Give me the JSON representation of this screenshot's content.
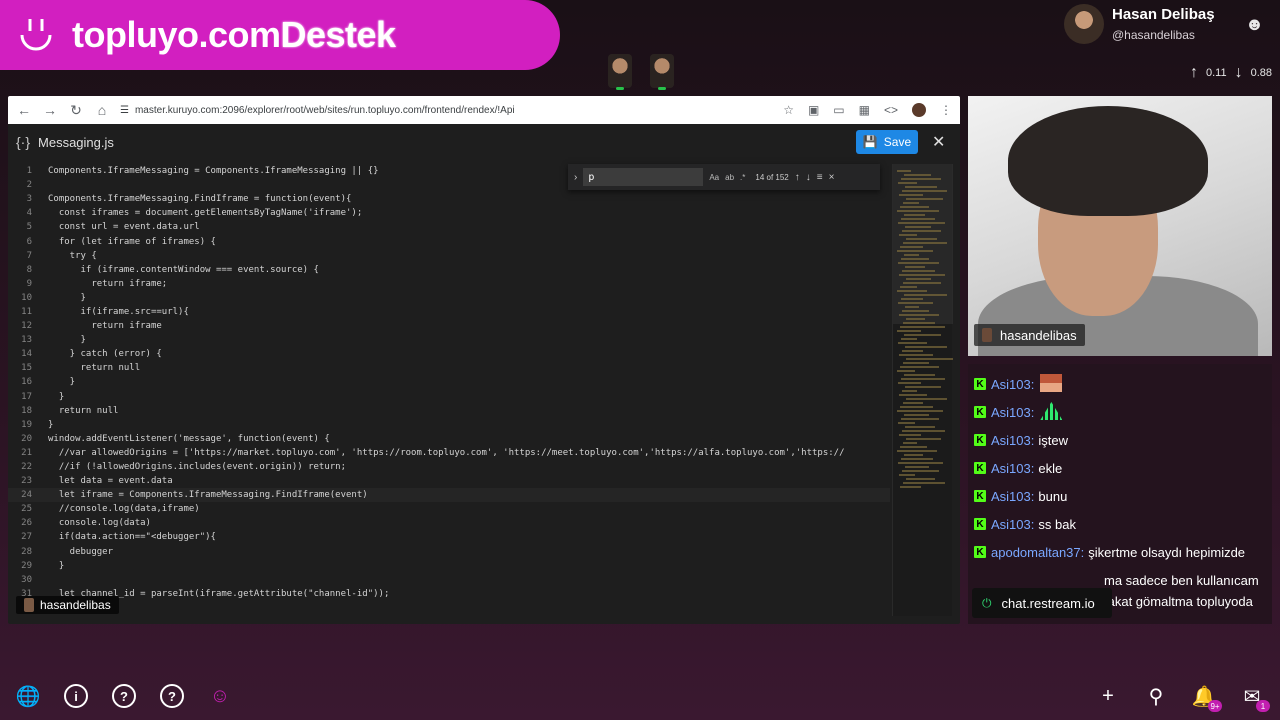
{
  "brand": {
    "name": "topluyo.com",
    "suffix": "Destek"
  },
  "user": {
    "name": "Hasan Delibaş",
    "handle": "@hasandelibas",
    "up": "0.11",
    "down": "0.88"
  },
  "browser": {
    "url": "master.kuruyo.com:2096/explorer/root/web/sites/run.topluyo.com/frontend/rendex/!Api"
  },
  "editor": {
    "filename": "Messaging.js",
    "save_label": "Save",
    "find": {
      "query": "p",
      "count": "14 of 152"
    },
    "lines": [
      {
        "n": "1",
        "code": "Components.IframeMessaging = Components.IframeMessaging || {}"
      },
      {
        "n": "2",
        "code": ""
      },
      {
        "n": "3",
        "code": "Components.IframeMessaging.FindIframe = function(event){"
      },
      {
        "n": "4",
        "code": "  const iframes = document.getElementsByTagName('iframe');"
      },
      {
        "n": "5",
        "code": "  const url = event.data.url"
      },
      {
        "n": "6",
        "code": "  for (let iframe of iframes) {"
      },
      {
        "n": "7",
        "code": "    try {"
      },
      {
        "n": "8",
        "code": "      if (iframe.contentWindow === event.source) {"
      },
      {
        "n": "9",
        "code": "        return iframe;"
      },
      {
        "n": "10",
        "code": "      }"
      },
      {
        "n": "11",
        "code": "      if(iframe.src==url){"
      },
      {
        "n": "12",
        "code": "        return iframe"
      },
      {
        "n": "13",
        "code": "      }"
      },
      {
        "n": "14",
        "code": "    } catch (error) {"
      },
      {
        "n": "15",
        "code": "      return null"
      },
      {
        "n": "16",
        "code": "    }"
      },
      {
        "n": "17",
        "code": "  }"
      },
      {
        "n": "18",
        "code": "  return null"
      },
      {
        "n": "19",
        "code": "}"
      },
      {
        "n": "20",
        "code": "window.addEventListener('message', function(event) {"
      },
      {
        "n": "21",
        "code": "  //var allowedOrigins = ['https://market.topluyo.com', 'https://room.topluyo.com', 'https://meet.topluyo.com','https://alfa.topluyo.com','https://"
      },
      {
        "n": "22",
        "code": "  //if (!allowedOrigins.includes(event.origin)) return;"
      },
      {
        "n": "23",
        "code": "  let data = event.data"
      },
      {
        "n": "24",
        "code": "  let iframe = Components.IframeMessaging.FindIframe(event)"
      },
      {
        "n": "25",
        "code": "  //console.log(data,iframe)"
      },
      {
        "n": "26",
        "code": "  console.log(data)"
      },
      {
        "n": "27",
        "code": "  if(data.action==\"<debugger\"){"
      },
      {
        "n": "28",
        "code": "    debugger"
      },
      {
        "n": "29",
        "code": "  }"
      },
      {
        "n": "30",
        "code": ""
      },
      {
        "n": "31",
        "code": "  let channel_id = parseInt(iframe.getAttribute(\"channel-id\"));"
      }
    ]
  },
  "camera_label": "hasandelibas",
  "webcam_label": "hasandelibas",
  "chat": [
    {
      "author": "Asi103:",
      "text": "",
      "emote": "e1"
    },
    {
      "author": "Asi103:",
      "text": "",
      "emote": "e2"
    },
    {
      "author": "Asi103:",
      "text": "iştew"
    },
    {
      "author": "Asi103:",
      "text": "ekle"
    },
    {
      "author": "Asi103:",
      "text": "bunu"
    },
    {
      "author": "Asi103:",
      "text": "ss bak"
    },
    {
      "author": "apodomaltan37:",
      "text": "şikertme olsaydı hepimizde"
    },
    {
      "author": "",
      "text": "ma sadece ben kullanıcam fakat gömaltma topluyoda"
    }
  ],
  "restream_label": "chat.restream.io",
  "bottom": {
    "notif_badge": "9+",
    "mail_badge": "1"
  }
}
